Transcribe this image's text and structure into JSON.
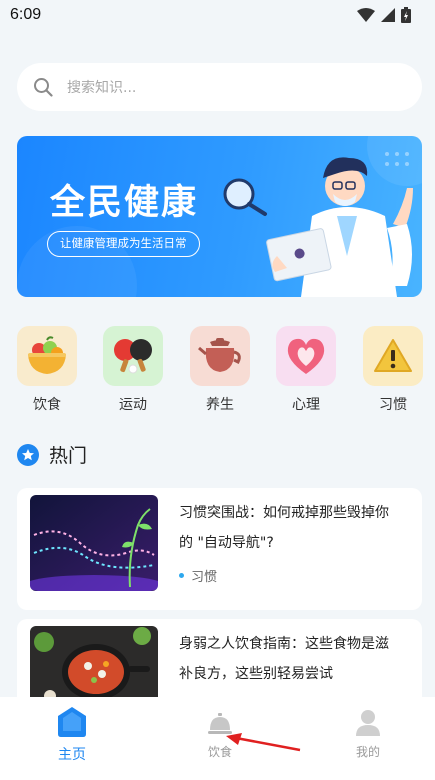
{
  "status_bar": {
    "time": "6:09"
  },
  "search": {
    "placeholder": "搜索知识..."
  },
  "banner": {
    "title": "全民健康",
    "subtitle": "让健康管理成为生活日常"
  },
  "categories": [
    {
      "label": "饮食",
      "icon": "food-bowl-icon",
      "bg": "#f9ebcd"
    },
    {
      "label": "运动",
      "icon": "ping-pong-icon",
      "bg": "#d6f3d3"
    },
    {
      "label": "养生",
      "icon": "teapot-icon",
      "bg": "#f7dcd4"
    },
    {
      "label": "心理",
      "icon": "heart-icon",
      "bg": "#f8def1"
    },
    {
      "label": "习惯",
      "icon": "warning-icon",
      "bg": "#fbecc4"
    }
  ],
  "section": {
    "title": "热门"
  },
  "articles": [
    {
      "title": "习惯突围战：如何戒掉那些毁掉你的 \"自动导航\"?",
      "tag": "习惯"
    },
    {
      "title": "身弱之人饮食指南：这些食物是滋补良方，这些别轻易尝试",
      "tag": ""
    }
  ],
  "nav": [
    {
      "label": "主页",
      "icon": "home-icon",
      "active": true
    },
    {
      "label": "饮食",
      "icon": "food-cloche-icon",
      "active": false
    },
    {
      "label": "我的",
      "icon": "user-icon",
      "active": false
    }
  ],
  "colors": {
    "accent": "#1f87f0",
    "banner": "#2f9bff",
    "tag_dot": "#2da8ee"
  }
}
